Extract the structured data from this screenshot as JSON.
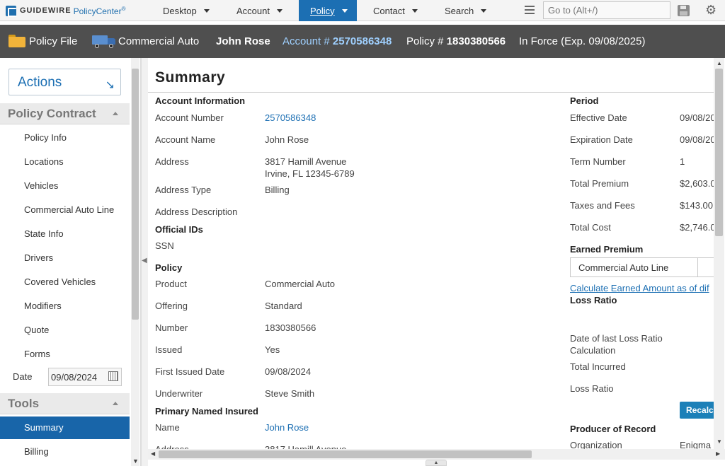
{
  "brand": {
    "name": "GUIDEWIRE",
    "product": "PolicyCenter",
    "mark": "®"
  },
  "nav": {
    "tabs": [
      {
        "label": "Desktop"
      },
      {
        "label": "Account"
      },
      {
        "label": "Policy"
      },
      {
        "label": "Contact"
      },
      {
        "label": "Search"
      }
    ],
    "goto_placeholder": "Go to (Alt+/)"
  },
  "infobar": {
    "policy_file": "Policy File",
    "line": "Commercial Auto",
    "insured": "John Rose",
    "account_prefix": "Account # ",
    "account_number": "2570586348",
    "policy_prefix": "Policy # ",
    "policy_number": "1830380566",
    "status": "In Force (Exp. 09/08/2025)"
  },
  "sidebar": {
    "actions_label": "Actions",
    "policy_contract_title": "Policy Contract",
    "items": [
      "Policy Info",
      "Locations",
      "Vehicles",
      "Commercial Auto Line",
      "State Info",
      "Drivers",
      "Covered Vehicles",
      "Modifiers",
      "Quote",
      "Forms"
    ],
    "date_label": "Date",
    "date_value": "09/08/2024",
    "tools_title": "Tools",
    "tools_items": [
      "Summary",
      "Billing"
    ]
  },
  "summary": {
    "title": "Summary",
    "account_info": {
      "heading": "Account Information",
      "account_number_label": "Account Number",
      "account_number": "2570586348",
      "account_name_label": "Account Name",
      "account_name": "John Rose",
      "address_label": "Address",
      "address_line1": "3817 Hamill Avenue",
      "address_line2": "Irvine, FL 12345-6789",
      "address_type_label": "Address Type",
      "address_type": "Billing",
      "address_description_label": "Address Description"
    },
    "official_ids": {
      "heading": "Official IDs",
      "ssn_label": "SSN"
    },
    "policy": {
      "heading": "Policy",
      "product_label": "Product",
      "product": "Commercial Auto",
      "offering_label": "Offering",
      "offering": "Standard",
      "number_label": "Number",
      "number": "1830380566",
      "issued_label": "Issued",
      "issued": "Yes",
      "first_issued_label": "First Issued Date",
      "first_issued": "09/08/2024",
      "underwriter_label": "Underwriter",
      "underwriter": "Steve Smith"
    },
    "primary_insured": {
      "heading": "Primary Named Insured",
      "name_label": "Name",
      "name": "John Rose",
      "address_label": "Address",
      "address": "3817 Hamill Avenue"
    },
    "period": {
      "heading": "Period",
      "effective_label": "Effective Date",
      "effective": "09/08/20",
      "expiration_label": "Expiration Date",
      "expiration": "09/08/20",
      "term_label": "Term Number",
      "term": "1",
      "premium_label": "Total Premium",
      "premium": "$2,603.0",
      "taxes_label": "Taxes and Fees",
      "taxes": "$143.00",
      "cost_label": "Total Cost",
      "cost": "$2,746.0"
    },
    "earned_premium": {
      "heading": "Earned Premium",
      "selected_line": "Commercial Auto Line",
      "calc_link": "Calculate Earned Amount as of dif"
    },
    "loss_ratio": {
      "heading": "Loss Ratio",
      "last_calc_label_1": "Date of last Loss Ratio",
      "last_calc_label_2": "Calculation",
      "total_incurred_label": "Total Incurred",
      "loss_ratio_label": "Loss Ratio",
      "recalc_button": "Recalcu"
    },
    "producer": {
      "heading": "Producer of Record",
      "organization_label": "Organization",
      "organization": "Enigma"
    }
  }
}
